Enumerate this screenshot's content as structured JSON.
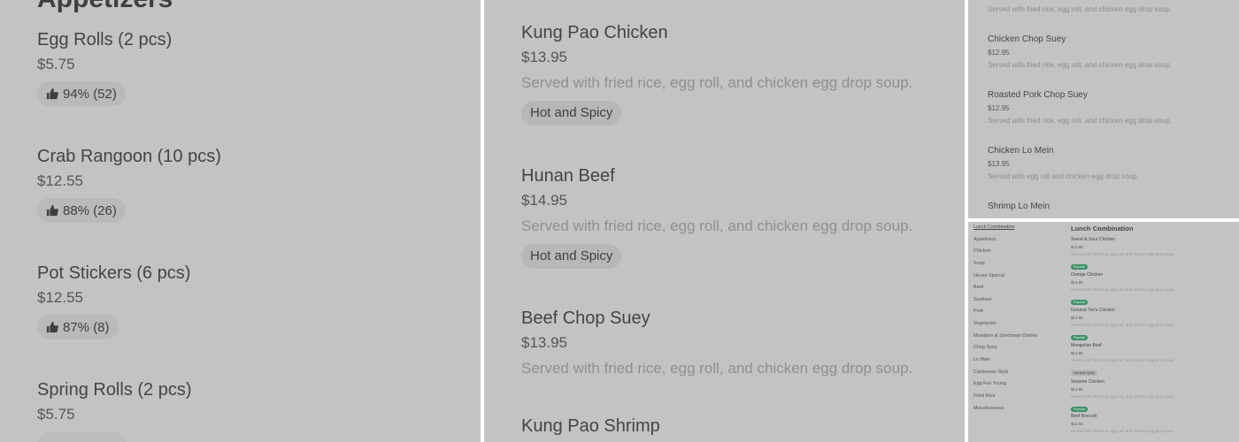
{
  "panel1": {
    "section_title": "Appetizers",
    "items": [
      {
        "name": "Egg Rolls (2 pcs)",
        "price": "$5.75",
        "rating": "94% (52)"
      },
      {
        "name": "Crab Rangoon (10 pcs)",
        "price": "$12.55",
        "rating": "88% (26)"
      },
      {
        "name": "Pot Stickers (6 pcs)",
        "price": "$12.55",
        "rating": "87% (8)"
      },
      {
        "name": "Spring Rolls (2 pcs)",
        "price": "$5.75"
      }
    ]
  },
  "panel2": {
    "items": [
      {
        "name": "Kung Pao Chicken",
        "price": "$13.95",
        "description": "Served with fried rice, egg roll, and chicken egg drop soup.",
        "tag": "Hot and Spicy"
      },
      {
        "name": "Hunan Beef",
        "price": "$14.95",
        "description": "Served with fried rice, egg roll, and chicken egg drop soup.",
        "tag": "Hot and Spicy"
      },
      {
        "name": "Beef Chop Suey",
        "price": "$13.95",
        "description": "Served with fried rice, egg roll, and chicken egg drop soup."
      },
      {
        "name": "Kung Pao Shrimp"
      }
    ]
  },
  "panel3": {
    "top_description": "Served with fried rice, egg roll, and chicken egg drop soup.",
    "items": [
      {
        "name": "Chicken Chop Suey",
        "price": "$12.95",
        "description": "Served with fried rice, egg roll, and chicken egg drop soup."
      },
      {
        "name": "Roasted Pork Chop Suey",
        "price": "$12.95",
        "description": "Served with fried rice, egg roll, and chicken egg drop soup."
      },
      {
        "name": "Chicken Lo Mein",
        "price": "$13.95",
        "description": "Served with egg roll and chicken egg drop soup."
      },
      {
        "name": "Shrimp Lo Mein"
      }
    ]
  },
  "panel4": {
    "section_title": "Lunch Combination",
    "sidebar": [
      "Lunch Combination",
      "Appetizers",
      "Chicken",
      "Soup",
      "House Special",
      "Beef",
      "Seafood",
      "Pork",
      "Vegetarian",
      "Mandarin & Szechwan Dishes",
      "Chop Suey",
      "Lo Mein",
      "Cantonese Style",
      "Egg Foo Young",
      "Fried Rice",
      "Miscellaneous"
    ],
    "items": [
      {
        "name": "Sweet & Sour Chicken",
        "price": "$13.95",
        "description": "Served with fried rice, egg roll, and chicken egg drop soup.",
        "tag": "Popular"
      },
      {
        "name": "Orange Chicken",
        "price": "$14.95",
        "description": "Served with fried rice, egg roll, and chicken egg drop soup.",
        "tag": "Popular"
      },
      {
        "name": "General Tso's Chicken",
        "price": "$14.95",
        "description": "Served with fried rice, egg roll, and chicken egg drop soup.",
        "tag": "Popular"
      },
      {
        "name": "Mongolian Beef",
        "price": "$14.95",
        "description": "Served with fried rice, egg roll, and chicken egg drop soup.",
        "tag": "Hot and Spicy"
      },
      {
        "name": "Sesame Chicken",
        "price": "$14.95",
        "description": "Served with fried rice, egg roll, and chicken egg drop soup.",
        "tag": "Popular"
      },
      {
        "name": "Beef Broccoli",
        "price": "$14.95",
        "description": "Served with fried rice, egg roll, and chicken egg drop soup."
      }
    ]
  },
  "colors": {
    "panel_bg": "#c3c3c3",
    "popular_badge": "#3d8f67",
    "spicy_badge": "#b0b0b0"
  }
}
